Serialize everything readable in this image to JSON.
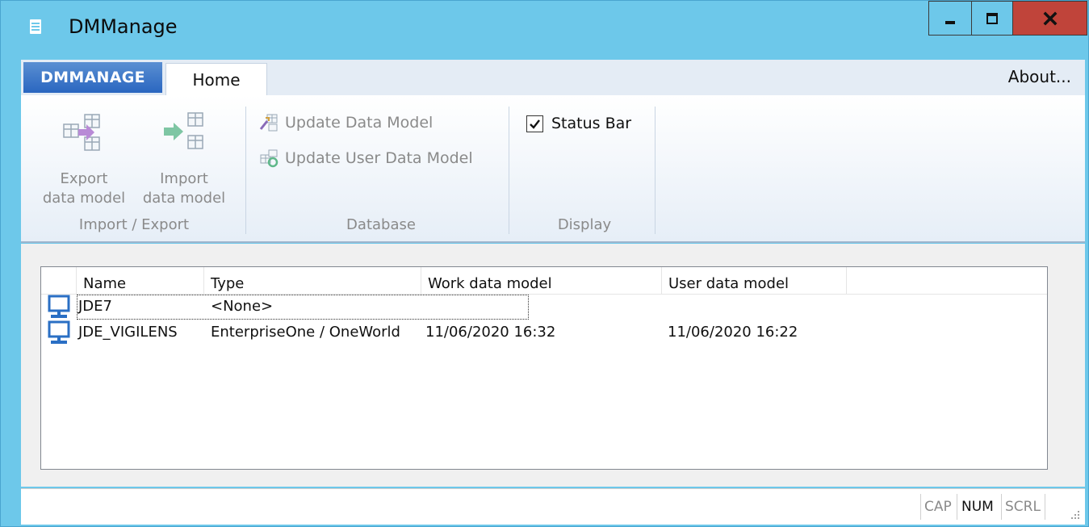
{
  "window": {
    "title": "DMManage",
    "minimize_label": "minimize",
    "maximize_label": "maximize",
    "close_label": "close"
  },
  "ribbon": {
    "app_tab": "DMMANAGE",
    "tabs": [
      {
        "label": "Home",
        "active": true
      }
    ],
    "about": "About...",
    "groups": {
      "import_export": {
        "label": "Import / Export",
        "export_btn": {
          "line1": "Export",
          "line2": "data model"
        },
        "import_btn": {
          "line1": "Import",
          "line2": "data model"
        }
      },
      "database": {
        "label": "Database",
        "update_data_model": "Update Data Model",
        "update_user_data_model": "Update User Data Model"
      },
      "display": {
        "label": "Display",
        "status_bar": {
          "label": "Status Bar",
          "checked": true
        }
      }
    }
  },
  "table": {
    "columns": [
      "Name",
      "Type",
      "Work data model",
      "User data model"
    ],
    "rows": [
      {
        "name": "JDE7",
        "type": "<None>",
        "work": "",
        "user": ""
      },
      {
        "name": "JDE_VIGILENS",
        "type": "EnterpriseOne / OneWorld",
        "work": "11/06/2020 16:32",
        "user": "11/06/2020 16:22"
      }
    ]
  },
  "statusbar": {
    "cap": "CAP",
    "num": "NUM",
    "scrl": "SCRL"
  },
  "colors": {
    "title_bg": "#6dc8ea",
    "close_btn": "#c0443a",
    "app_tab": "#2a66c0"
  }
}
